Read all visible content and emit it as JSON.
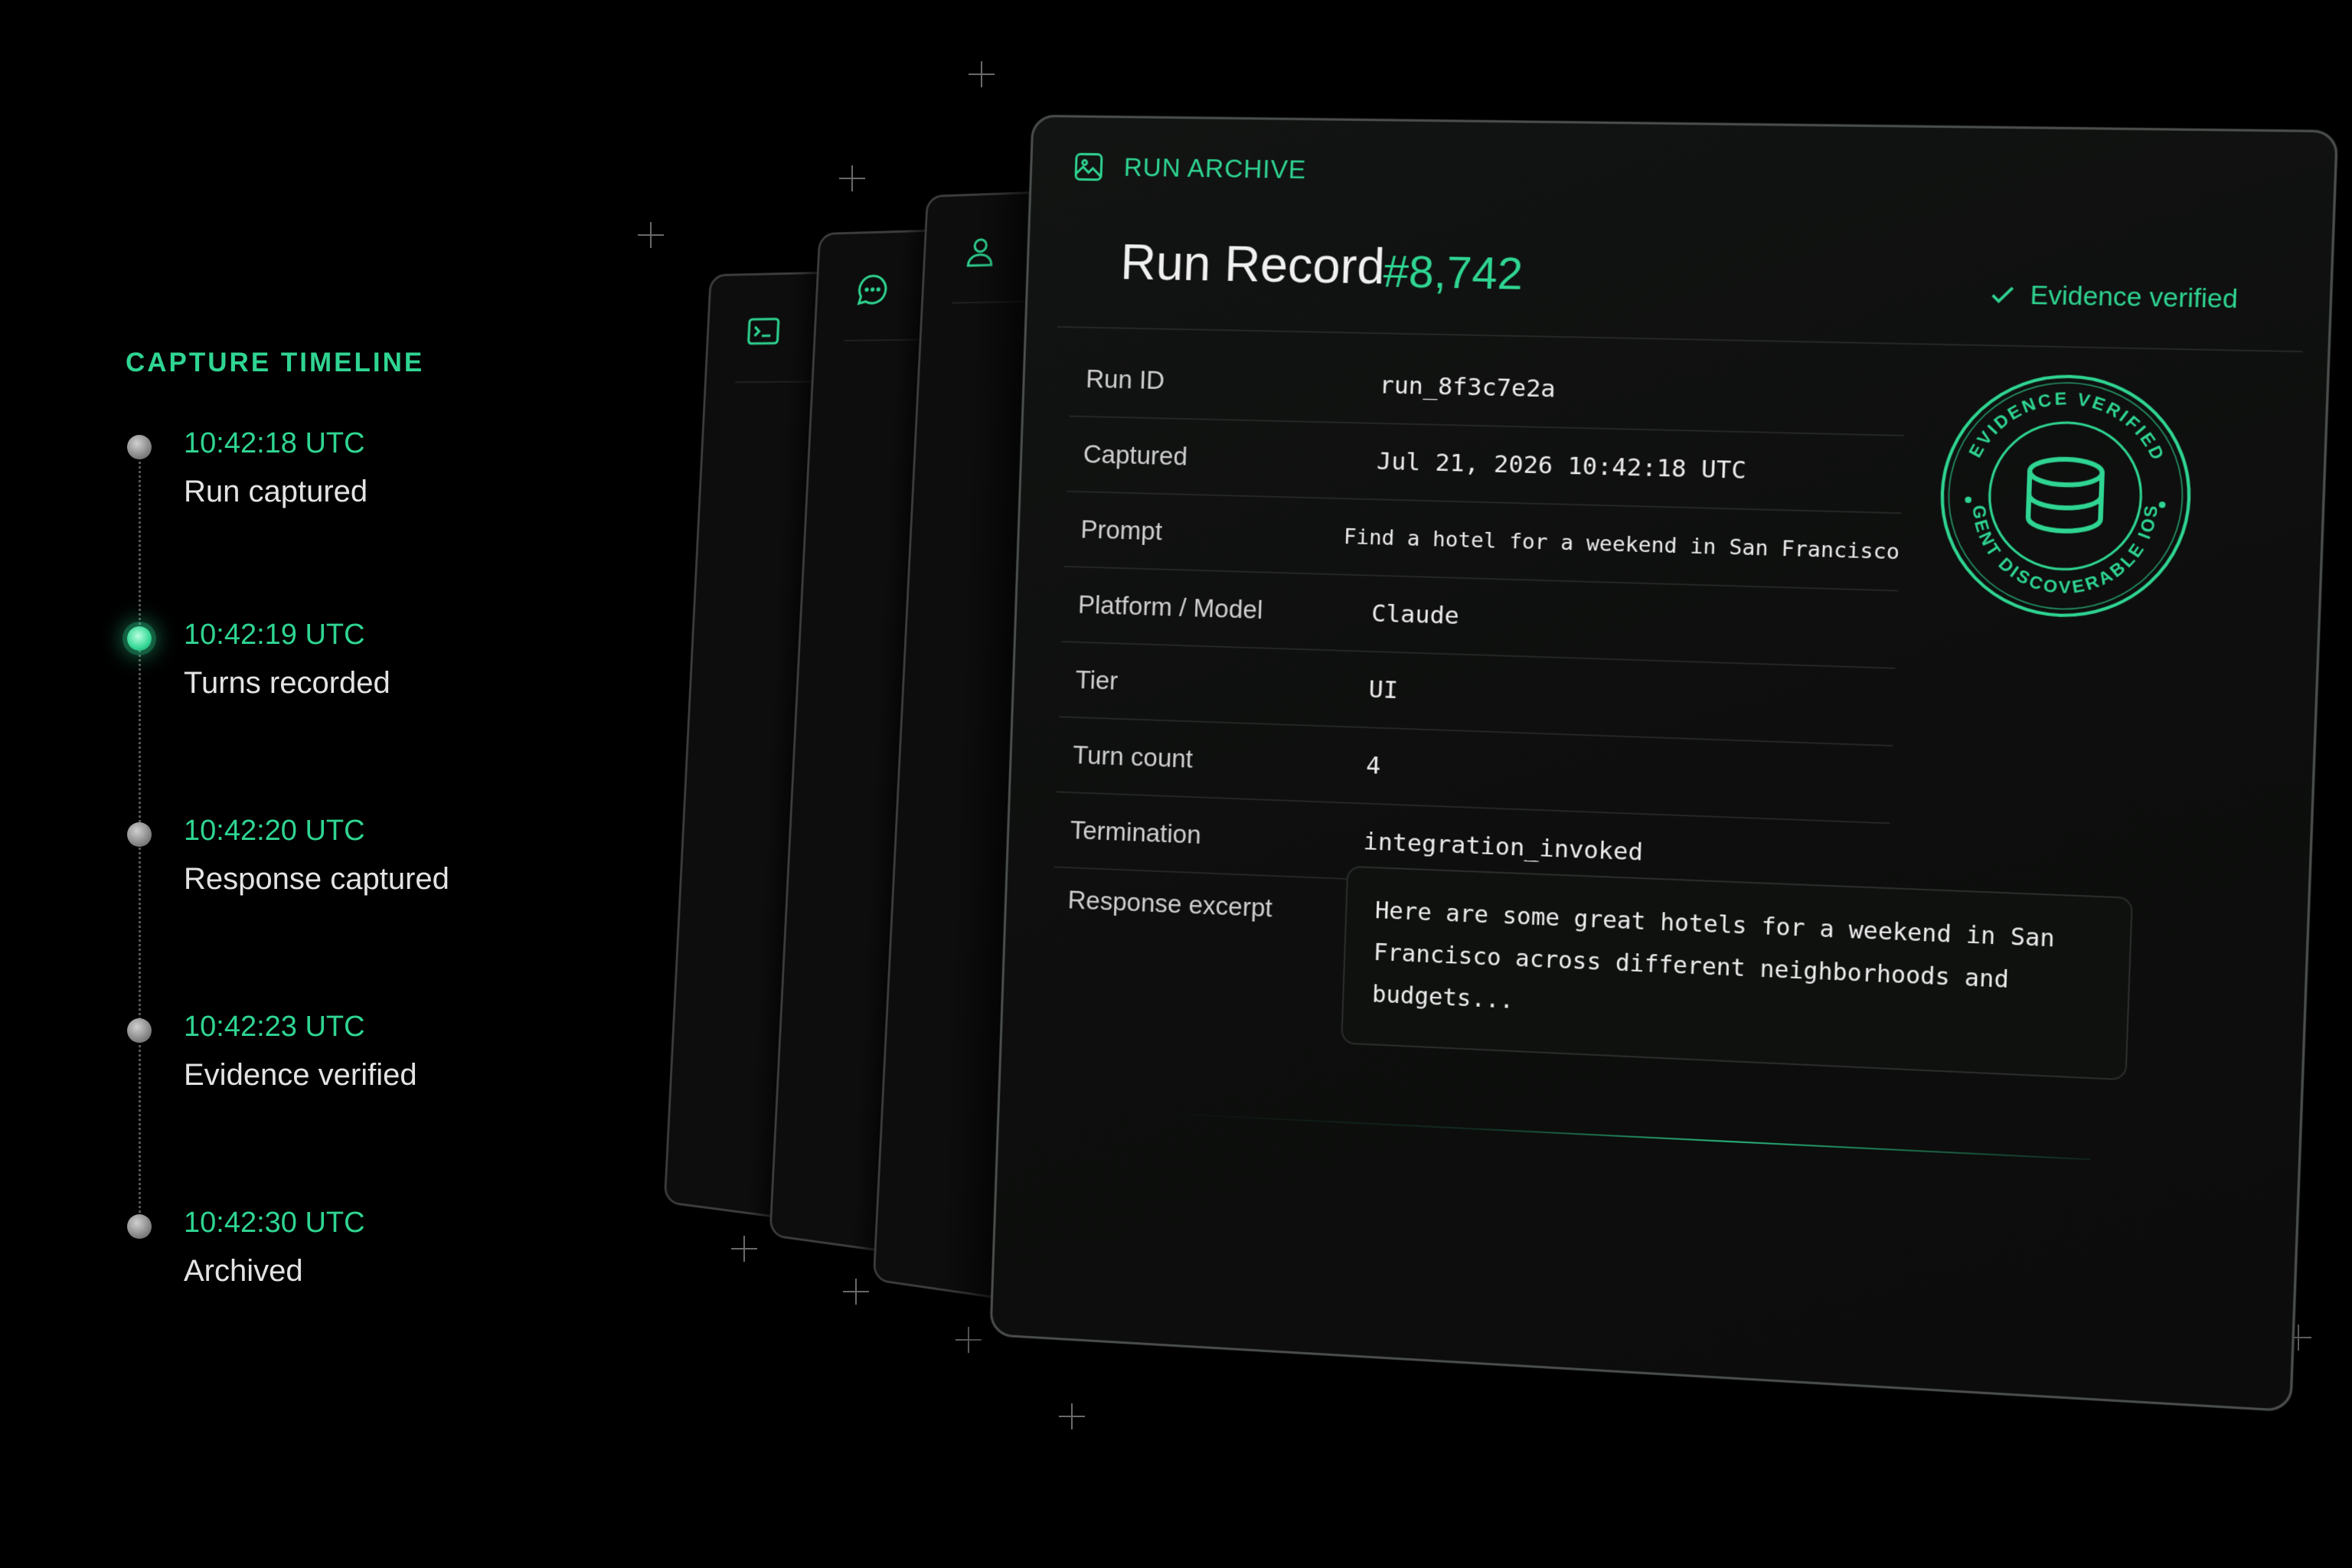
{
  "timeline": {
    "heading": "CAPTURE TIMELINE",
    "events": [
      {
        "time": "10:42:18 UTC",
        "label": "Run captured",
        "active": false
      },
      {
        "time": "10:42:19 UTC",
        "label": "Turns recorded",
        "active": true
      },
      {
        "time": "10:42:20 UTC",
        "label": "Response captured",
        "active": false
      },
      {
        "time": "10:42:23 UTC",
        "label": "Evidence verified",
        "active": false
      },
      {
        "time": "10:42:30 UTC",
        "label": "Archived",
        "active": false
      }
    ]
  },
  "card": {
    "section_label": "RUN ARCHIVE",
    "title": "Run Record",
    "record_number": "#8,742",
    "verified_label": "Evidence verified",
    "fields": [
      {
        "key": "Run ID",
        "value": "run_8f3c7e2a"
      },
      {
        "key": "Captured",
        "value": "Jul 21, 2026 10:42:18 UTC"
      },
      {
        "key": "Prompt",
        "value": "Find a hotel for a weekend in San Francisco"
      },
      {
        "key": "Platform / Model",
        "value": "Claude"
      },
      {
        "key": "Tier",
        "value": "UI"
      },
      {
        "key": "Turn count",
        "value": "4"
      },
      {
        "key": "Termination",
        "value": "integration_invoked"
      }
    ],
    "excerpt_label": "Response excerpt",
    "excerpt_text": "Here are some great hotels for a weekend in San Francisco across different neighborhoods and budgets...",
    "seal": {
      "top_text": "EVIDENCE VERIFIED",
      "bottom_text": "AGENT DISCOVERABLE IOS!"
    }
  },
  "back_cards": [
    {
      "icon": "terminal-icon"
    },
    {
      "icon": "chat-bubble-icon"
    },
    {
      "icon": "user-icon"
    }
  ],
  "colors": {
    "accent": "#2fd592",
    "background": "#000000",
    "card": "#0d0e0d"
  }
}
